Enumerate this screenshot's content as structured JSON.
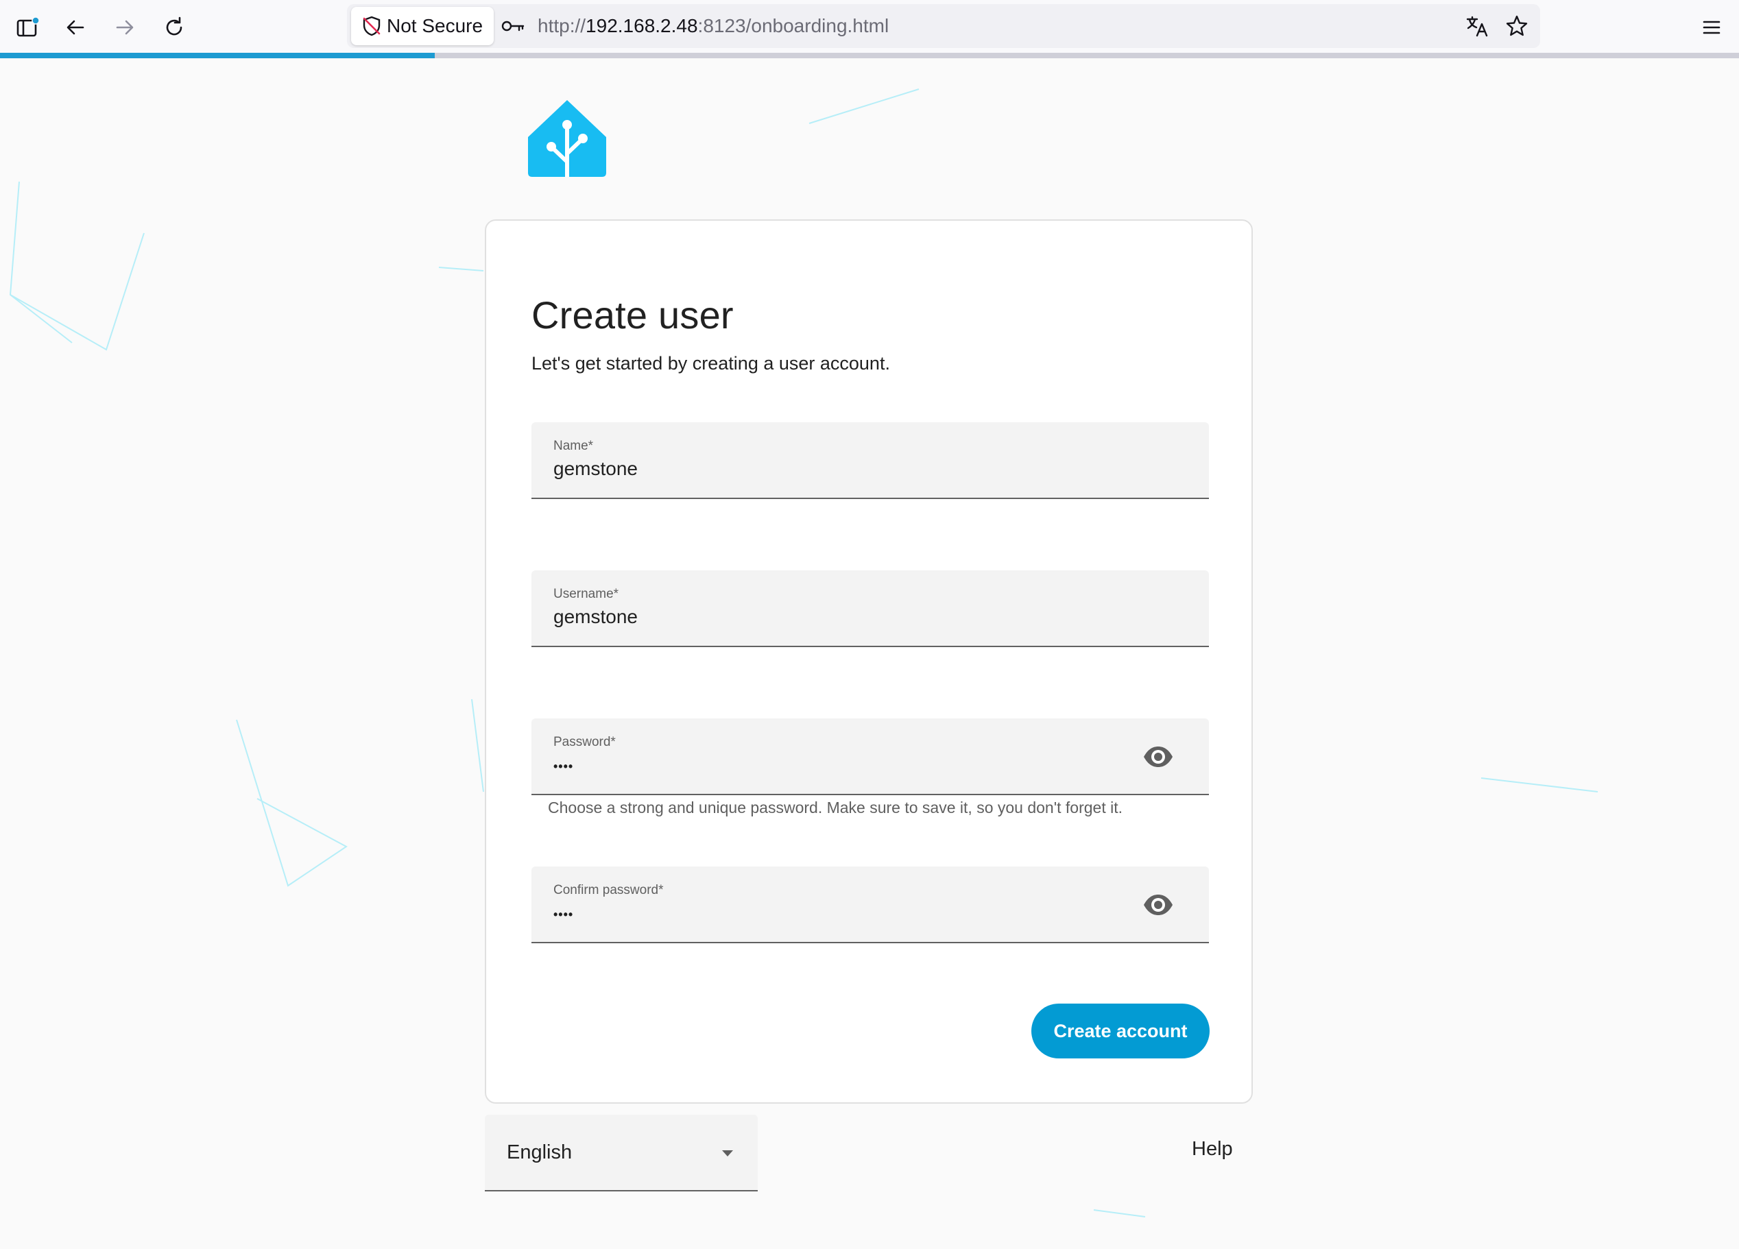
{
  "browser": {
    "security_label": "Not Secure",
    "url_scheme": "http://",
    "url_host": "192.168.2.48",
    "url_rest": ":8123/onboarding.html",
    "load_progress_percent": 25,
    "icons": {
      "sidebar": "sidebar-icon",
      "back": "back-arrow-icon",
      "forward": "forward-arrow-icon",
      "reload": "reload-icon",
      "key": "key-icon",
      "translate": "translate-icon",
      "bookmark": "star-icon",
      "menu": "hamburger-menu-icon"
    }
  },
  "brand": {
    "logo_icon": "home-assistant-logo",
    "accent_color": "#18bcf2"
  },
  "form": {
    "title": "Create user",
    "subtitle": "Let's get started by creating a user account.",
    "name": {
      "label": "Name*",
      "value": "gemstone"
    },
    "username": {
      "label": "Username*",
      "value": "gemstone"
    },
    "password": {
      "label": "Password*",
      "masked_value": "••••",
      "helper": "Choose a strong and unique password. Make sure to save it, so you don't forget it."
    },
    "confirm_password": {
      "label": "Confirm password*",
      "masked_value": "••••"
    },
    "submit_label": "Create account",
    "button_color": "#039bd3"
  },
  "footer": {
    "language": "English",
    "help_label": "Help"
  }
}
